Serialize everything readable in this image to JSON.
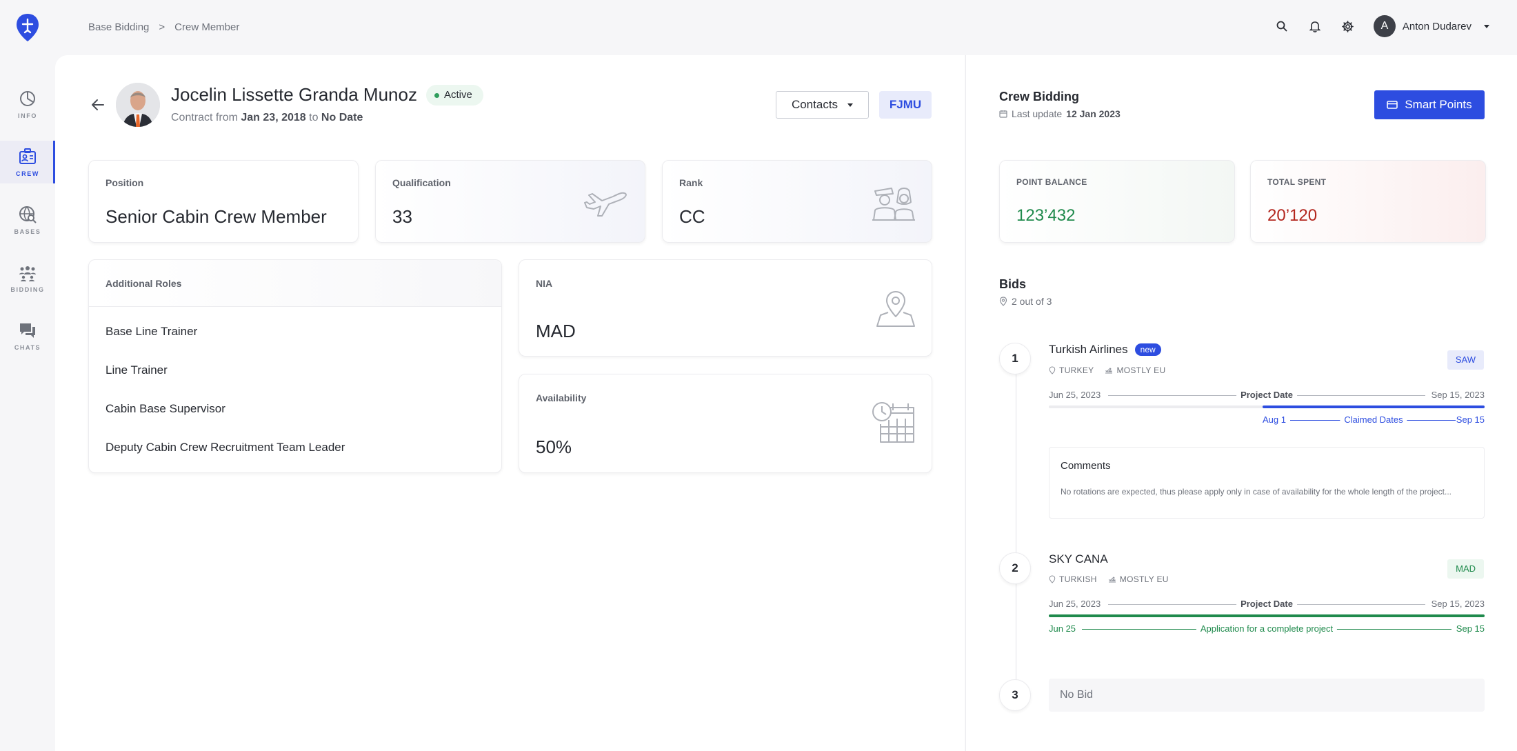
{
  "breadcrumb": {
    "root": "Base Bidding",
    "separator": ">",
    "current": "Crew Member"
  },
  "nav": [
    {
      "label": "INFO",
      "icon": "chart-pie-icon"
    },
    {
      "label": "CREW",
      "icon": "crew-id-icon",
      "active": true
    },
    {
      "label": "BASES",
      "icon": "globe-search-icon"
    },
    {
      "label": "BIDDING",
      "icon": "group-icon"
    },
    {
      "label": "CHATS",
      "icon": "chat-icon"
    }
  ],
  "user": {
    "initial": "A",
    "name": "Anton Dudarev"
  },
  "profile": {
    "name": "Jocelin Lissette Granda Munoz",
    "status": "Active",
    "contract_prefix": "Contract from",
    "contract_from": "Jan 23, 2018",
    "contract_to_word": "to",
    "contract_to": "No Date",
    "contacts_label": "Contacts",
    "code": "FJMU"
  },
  "cards": {
    "position": {
      "label": "Position",
      "value": "Senior Cabin Crew Member"
    },
    "qualification": {
      "label": "Qualification",
      "value": "33"
    },
    "rank": {
      "label": "Rank",
      "value": "CC"
    },
    "nia": {
      "label": "NIA",
      "value": "MAD"
    },
    "availability": {
      "label": "Availability",
      "value": "50%"
    }
  },
  "roles": {
    "title": "Additional Roles",
    "items": [
      "Base Line Trainer",
      "Line Trainer",
      "Cabin Base Supervisor",
      "Deputy Cabin Crew Recruitment Team Leader"
    ]
  },
  "bidding": {
    "title": "Crew Bidding",
    "last_update_label": "Last update",
    "last_update": "12 Jan 2023",
    "smart_points_label": "Smart Points",
    "point_balance_label": "POINT BALANCE",
    "point_balance": "123’432",
    "total_spent_label": "TOTAL SPENT",
    "total_spent": "20’120",
    "bids_title": "Bids",
    "bids_count": "2 out of 3"
  },
  "bids": [
    {
      "num": "1",
      "airline": "Turkish Airlines",
      "tag": "new",
      "country": "TURKEY",
      "region": "MOSTLY EU",
      "base": "SAW",
      "start": "Jun 25, 2023",
      "end": "Sep 15, 2023",
      "project_label": "Project Date",
      "claim_start": "Aug 1",
      "claim_end": "Sep 15",
      "claim_label": "Claimed Dates",
      "claim_fraction_start": 0.49,
      "claim_fraction_end": 1.0,
      "comments_title": "Comments",
      "comments_text": "No rotations are expected, thus please apply only in case of availability for the whole length of the project..."
    },
    {
      "num": "2",
      "airline": "SKY CANA",
      "country": "TURKISH",
      "region": "MOSTLY EU",
      "base": "MAD",
      "start": "Jun 25, 2023",
      "end": "Sep 15, 2023",
      "project_label": "Project Date",
      "claim_start": "Jun 25",
      "claim_end": "Sep 15",
      "claim_label": "Application for a complete project",
      "claim_fraction_start": 0.0,
      "claim_fraction_end": 1.0
    },
    {
      "num": "3",
      "empty_label": "No Bid"
    }
  ],
  "colors": {
    "accent": "#2d4de0",
    "green": "#1f8a4c",
    "red": "#b3261e",
    "active_dot": "#2f9d5c"
  }
}
